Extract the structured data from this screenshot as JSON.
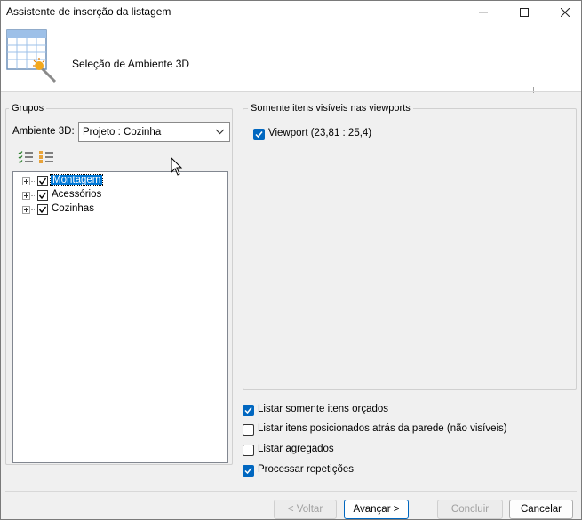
{
  "window": {
    "title": "Assistente de inserção da listagem"
  },
  "header": {
    "title": "Seleção de Ambiente 3D"
  },
  "groups": {
    "label": "Grupos",
    "ambiente_label": "Ambiente 3D:",
    "ambiente_value": "Projeto : Cozinha",
    "tree": [
      {
        "label": "Montagem",
        "checked": true,
        "selected": true
      },
      {
        "label": "Acessórios",
        "checked": true,
        "selected": false
      },
      {
        "label": "Cozinhas",
        "checked": true,
        "selected": false
      }
    ]
  },
  "viewports": {
    "label": "Somente itens visíveis nas viewports",
    "items": [
      {
        "label": "Viewport (23,81 : 25,4)",
        "checked": true
      }
    ]
  },
  "options": [
    {
      "label": "Listar somente itens orçados",
      "checked": true
    },
    {
      "label": "Listar itens posicionados atrás da parede (não visíveis)",
      "checked": false
    },
    {
      "label": "Listar agregados",
      "checked": false
    },
    {
      "label": "Processar repetições",
      "checked": true
    }
  ],
  "buttons": {
    "back": "< Voltar",
    "next": "Avançar >",
    "finish": "Concluir",
    "cancel": "Cancelar"
  },
  "colors": {
    "accent": "#0067c0",
    "selection": "#0078d7"
  }
}
